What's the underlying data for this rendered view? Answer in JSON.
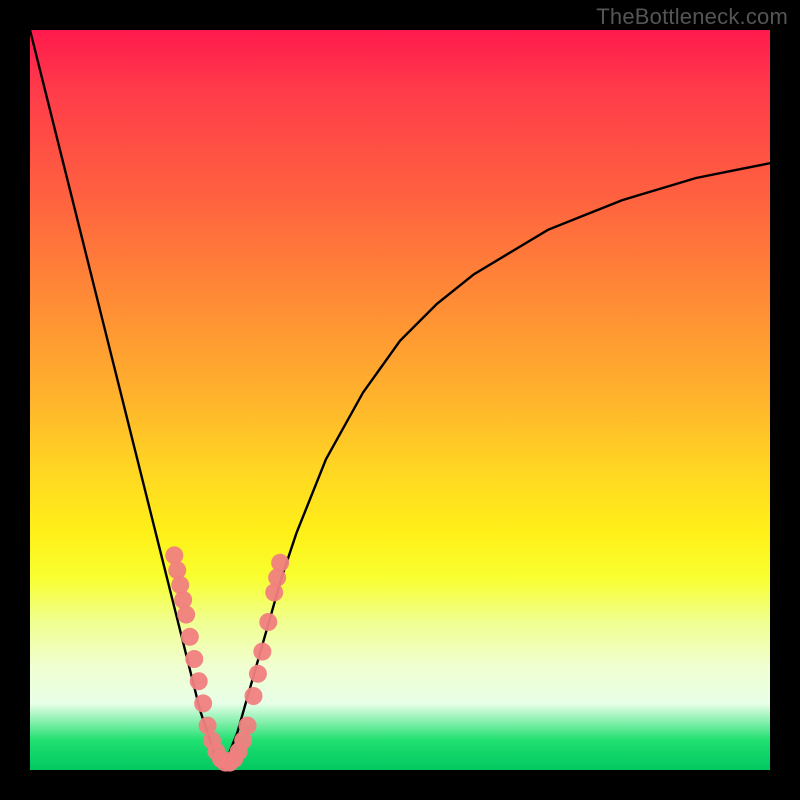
{
  "watermark": "TheBottleneck.com",
  "chart_data": {
    "type": "line",
    "title": "",
    "xlabel": "",
    "ylabel": "",
    "xlim": [
      0,
      100
    ],
    "ylim": [
      0,
      100
    ],
    "grid": false,
    "legend": false,
    "series": [
      {
        "name": "left-curve",
        "x": [
          0,
          2,
          4,
          6,
          8,
          10,
          12,
          14,
          16,
          18,
          20,
          21,
          22,
          23,
          24,
          25,
          26
        ],
        "y": [
          100,
          92,
          84,
          76,
          68,
          60,
          52,
          44,
          36,
          28,
          20,
          16,
          12,
          8,
          5,
          2,
          0
        ]
      },
      {
        "name": "right-curve",
        "x": [
          26,
          28,
          30,
          32,
          34,
          36,
          40,
          45,
          50,
          55,
          60,
          65,
          70,
          75,
          80,
          85,
          90,
          95,
          100
        ],
        "y": [
          0,
          5,
          12,
          19,
          26,
          32,
          42,
          51,
          58,
          63,
          67,
          70,
          73,
          75,
          77,
          78.5,
          80,
          81,
          82
        ]
      }
    ],
    "markers": [
      {
        "name": "pink-dots",
        "color": "#f08080",
        "points": [
          {
            "x": 19.5,
            "y": 29
          },
          {
            "x": 19.9,
            "y": 27
          },
          {
            "x": 20.3,
            "y": 25
          },
          {
            "x": 20.7,
            "y": 23
          },
          {
            "x": 21.1,
            "y": 21
          },
          {
            "x": 21.6,
            "y": 18
          },
          {
            "x": 22.2,
            "y": 15
          },
          {
            "x": 22.8,
            "y": 12
          },
          {
            "x": 23.4,
            "y": 9
          },
          {
            "x": 24.0,
            "y": 6
          },
          {
            "x": 24.6,
            "y": 4
          },
          {
            "x": 25.2,
            "y": 2.5
          },
          {
            "x": 25.8,
            "y": 1.5
          },
          {
            "x": 26.4,
            "y": 1
          },
          {
            "x": 27.0,
            "y": 1
          },
          {
            "x": 27.6,
            "y": 1.5
          },
          {
            "x": 28.2,
            "y": 2.5
          },
          {
            "x": 28.8,
            "y": 4
          },
          {
            "x": 29.4,
            "y": 6
          },
          {
            "x": 30.2,
            "y": 10
          },
          {
            "x": 30.8,
            "y": 13
          },
          {
            "x": 31.4,
            "y": 16
          },
          {
            "x": 32.2,
            "y": 20
          },
          {
            "x": 33.0,
            "y": 24
          },
          {
            "x": 33.4,
            "y": 26
          },
          {
            "x": 33.8,
            "y": 28
          }
        ]
      }
    ]
  }
}
